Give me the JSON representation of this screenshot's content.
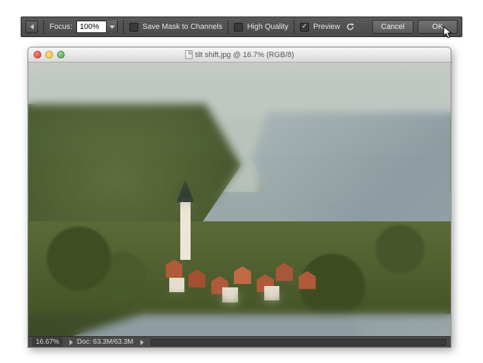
{
  "options_bar": {
    "focus_label": "Focus:",
    "focus_value": "100%",
    "save_mask_checked": false,
    "save_mask_label": "Save Mask to Channels",
    "high_quality_checked": false,
    "high_quality_label": "High Quality",
    "preview_checked": true,
    "preview_label": "Preview",
    "reset_tooltip": "Reset",
    "cancel_label": "Cancel",
    "ok_label": "OK"
  },
  "document": {
    "title": "tilt shift.jpg @ 16.7% (RGB/8)",
    "zoom_display": "16.67%",
    "doc_size": "Doc: 63.3M/63.3M"
  }
}
